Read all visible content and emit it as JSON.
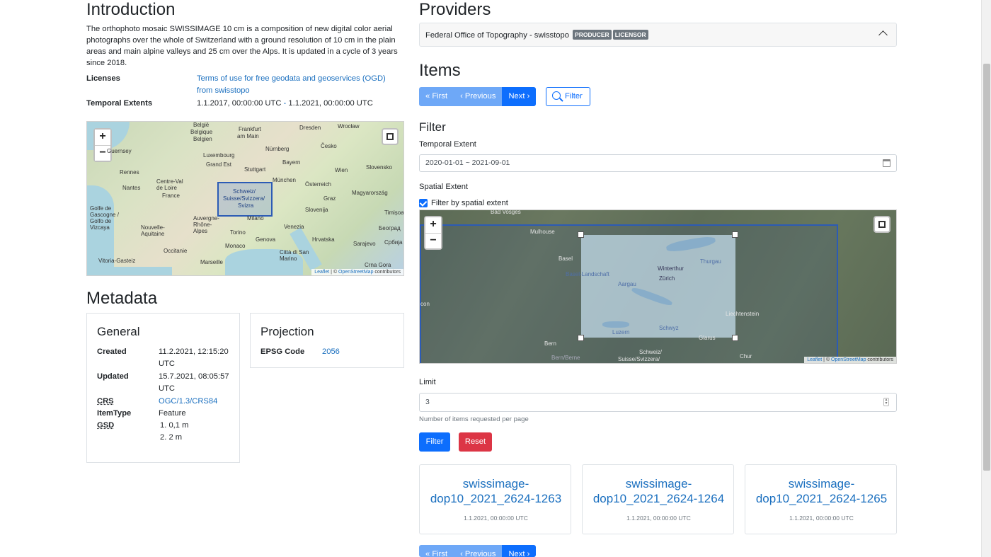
{
  "intro": {
    "title": "Introduction",
    "text": "The orthophoto mosaic SWISSIMAGE 10 cm is a composition of new digital color aerial photographs over the whole of Switzerland with a ground resolution of 10 cm in the plain areas and main alpine valleys and 25 cm over the Alps. It is updated in a cycle of 3 years since 2018.",
    "licenses_label": "Licenses",
    "licenses_value": "Terms of use for free geodata and geoservices (OGD) from swisstopo",
    "temporal_label": "Temporal Extents",
    "temporal_start": "1.1.2017, 00:00:00 UTC",
    "temporal_sep": " - ",
    "temporal_end": "1.1.2021, 00:00:00 UTC"
  },
  "map_small": {
    "zoom_in": "+",
    "zoom_out": "−",
    "labels": [
      "België",
      "Belgique",
      "Belgien",
      "Frankfurt",
      "am Main",
      "Dresden",
      "Wrocław",
      "Česko",
      "Nürnberg",
      "Luxembourg",
      "Bayern",
      "Rennes",
      "Stuttgart",
      "Wien",
      "Slovensko",
      "Nantes",
      "France",
      "München",
      "Österreich",
      "Magyarország",
      "Schweiz/",
      "Suisse/Svizzera/",
      "Svizra",
      "Graz",
      "Slovenija",
      "Golfe de Gascogne / Golfo de Vizcaya",
      "Nouvelle-Aquitaine",
      "Auvergne-Rhône-Alpes",
      "Milano",
      "Venezia",
      "Torino",
      "Genova",
      "Hrvatska",
      "Sarajevo",
      "Србија",
      "Monaco",
      "Città di San Marino",
      "Marseille",
      "Crna Gora",
      "Vitoria-Gasteiz",
      "Occitanie",
      "Timișoara",
      "Београд",
      "Grand Est",
      "Centre-Val de Loire",
      "Guernsey"
    ],
    "attribution_leaflet": "Leaflet",
    "attribution_sep": " | © ",
    "attribution_osm": "OpenStreetMap",
    "attribution_suffix": " contributors"
  },
  "metadata": {
    "title": "Metadata",
    "general": {
      "title": "General",
      "created_label": "Created",
      "created_value_1": "11.2.2021, 12:15:20",
      "created_value_2": "UTC",
      "updated_label": "Updated",
      "updated_value_1": "15.7.2021, 08:05:57",
      "updated_value_2": "UTC",
      "crs_label": "CRS",
      "crs_value": "OGC/1.3/CRS84",
      "itemtype_label": "ItemType",
      "itemtype_value": "Feature",
      "gsd_label": "GSD",
      "gsd_values": [
        "1. 0,1 m",
        "2. 2 m"
      ]
    },
    "projection": {
      "title": "Projection",
      "epsg_label": "EPSG Code",
      "epsg_value": "2056"
    }
  },
  "providers": {
    "title": "Providers",
    "name": "Federal Office of Topography - swisstopo",
    "badges": [
      "PRODUCER",
      "LICENSOR"
    ]
  },
  "items": {
    "title": "Items",
    "pager": {
      "first": "« First",
      "previous": "‹ Previous",
      "next": "Next ›"
    },
    "filter_button": "Filter"
  },
  "filter": {
    "title": "Filter",
    "temporal_label": "Temporal Extent",
    "temporal_value": "2020-01-01 ~ 2021-09-01",
    "spatial_label": "Spatial Extent",
    "spatial_checkbox": "Filter by spatial extent",
    "limit_label": "Limit",
    "limit_value": "3",
    "limit_help": "Number of items requested per page",
    "submit": "Filter",
    "reset": "Reset"
  },
  "map_large": {
    "zoom_in": "+",
    "zoom_out": "−",
    "labels": [
      "Bad Vosges",
      "Mulhouse",
      "Basel",
      "Basel-Landschaft",
      "Aargau",
      "Zürich",
      "Winterthur",
      "Thurgau",
      "Liechtenstein",
      "Luzern",
      "Schwyz",
      "Glarus",
      "Bern",
      "Bern/Berne",
      "Schweiz/",
      "Suisse/Svizzera/",
      "Chur",
      "con"
    ],
    "attribution_leaflet": "Leaflet",
    "attribution_sep": " | © ",
    "attribution_osm": "OpenStreetMap",
    "attribution_suffix": " contributors"
  },
  "item_cards": [
    {
      "title_1": "swissimage-",
      "title_2": "dop10_2021_2624-1263",
      "date": "1.1.2021, 00:00:00 UTC"
    },
    {
      "title_1": "swissimage-",
      "title_2": "dop10_2021_2624-1264",
      "date": "1.1.2021, 00:00:00 UTC"
    },
    {
      "title_1": "swissimage-",
      "title_2": "dop10_2021_2624-1265",
      "date": "1.1.2021, 00:00:00 UTC"
    }
  ],
  "colors": {
    "primary": "#0d6efd",
    "primary_disabled": "#6ea8f7",
    "danger": "#dc3545",
    "link": "#1a6fbf",
    "badge": "#6c757d",
    "spatial_box": "#2c5bb5"
  }
}
